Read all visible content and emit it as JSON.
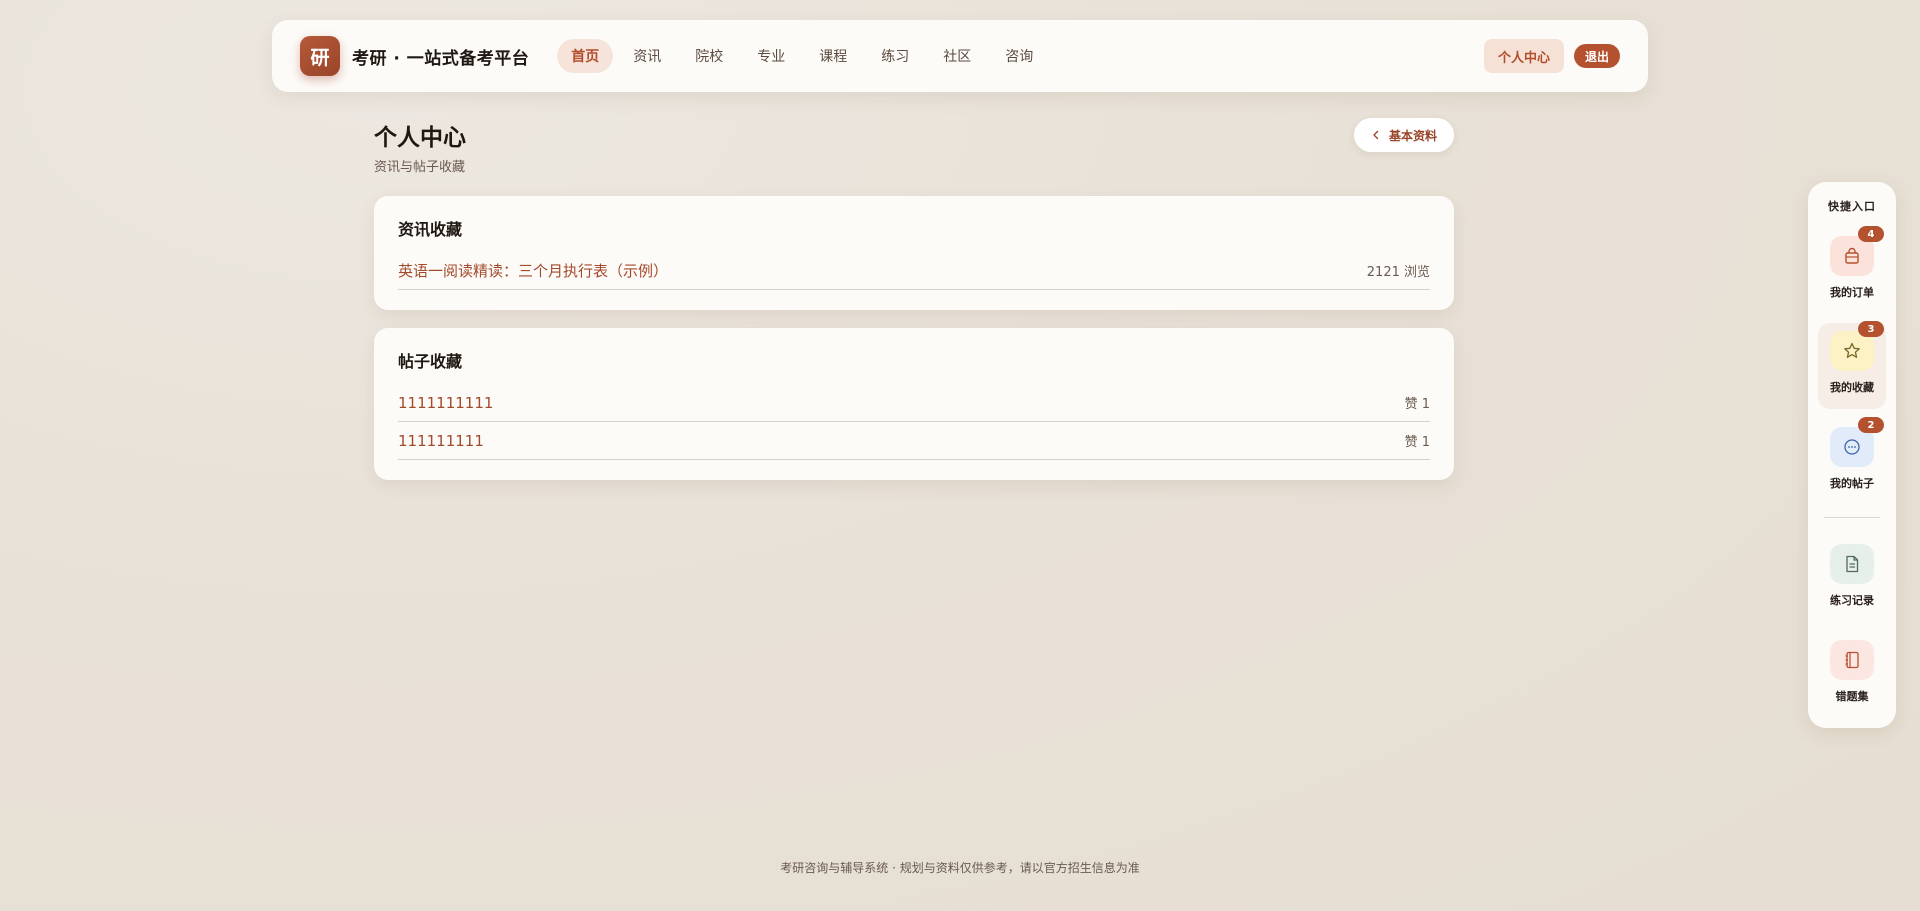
{
  "nav": {
    "logo_char": "研",
    "brand": "考研 · 一站式备考平台",
    "links": [
      "首页",
      "资讯",
      "院校",
      "专业",
      "课程",
      "练习",
      "社区",
      "咨询"
    ],
    "profile_label": "个人中心",
    "logout_label": "退出"
  },
  "page": {
    "title": "个人中心",
    "subtitle": "资讯与帖子收藏",
    "back_label": "基本资料"
  },
  "news_favorites": {
    "title": "资讯收藏",
    "items": [
      {
        "title": "英语一阅读精读：三个月执行表（示例）",
        "meta": "2121 浏览"
      }
    ]
  },
  "post_favorites": {
    "title": "帖子收藏",
    "items": [
      {
        "title": "1111111111",
        "meta": "赞 1"
      },
      {
        "title": "111111111",
        "meta": "赞 1"
      }
    ]
  },
  "quick": {
    "title": "快捷入口",
    "items": [
      {
        "label": "我的订单",
        "badge": "4",
        "icon": "shopping-bag-icon",
        "color": "#fbe3dc"
      },
      {
        "label": "我的收藏",
        "badge": "3",
        "icon": "star-icon",
        "color": "#fdf1c6"
      },
      {
        "label": "我的帖子",
        "badge": "2",
        "icon": "chat-bubble-icon",
        "color": "#e1ebfa"
      },
      {
        "label": "练习记录",
        "badge": "",
        "icon": "document-icon",
        "color": "#e6efe9"
      },
      {
        "label": "错题集",
        "badge": "",
        "icon": "notebook-icon",
        "color": "#fbe6e2"
      }
    ]
  },
  "footer": "考研咨询与辅导系统 · 规划与资料仅供参考，请以官方招生信息为准"
}
